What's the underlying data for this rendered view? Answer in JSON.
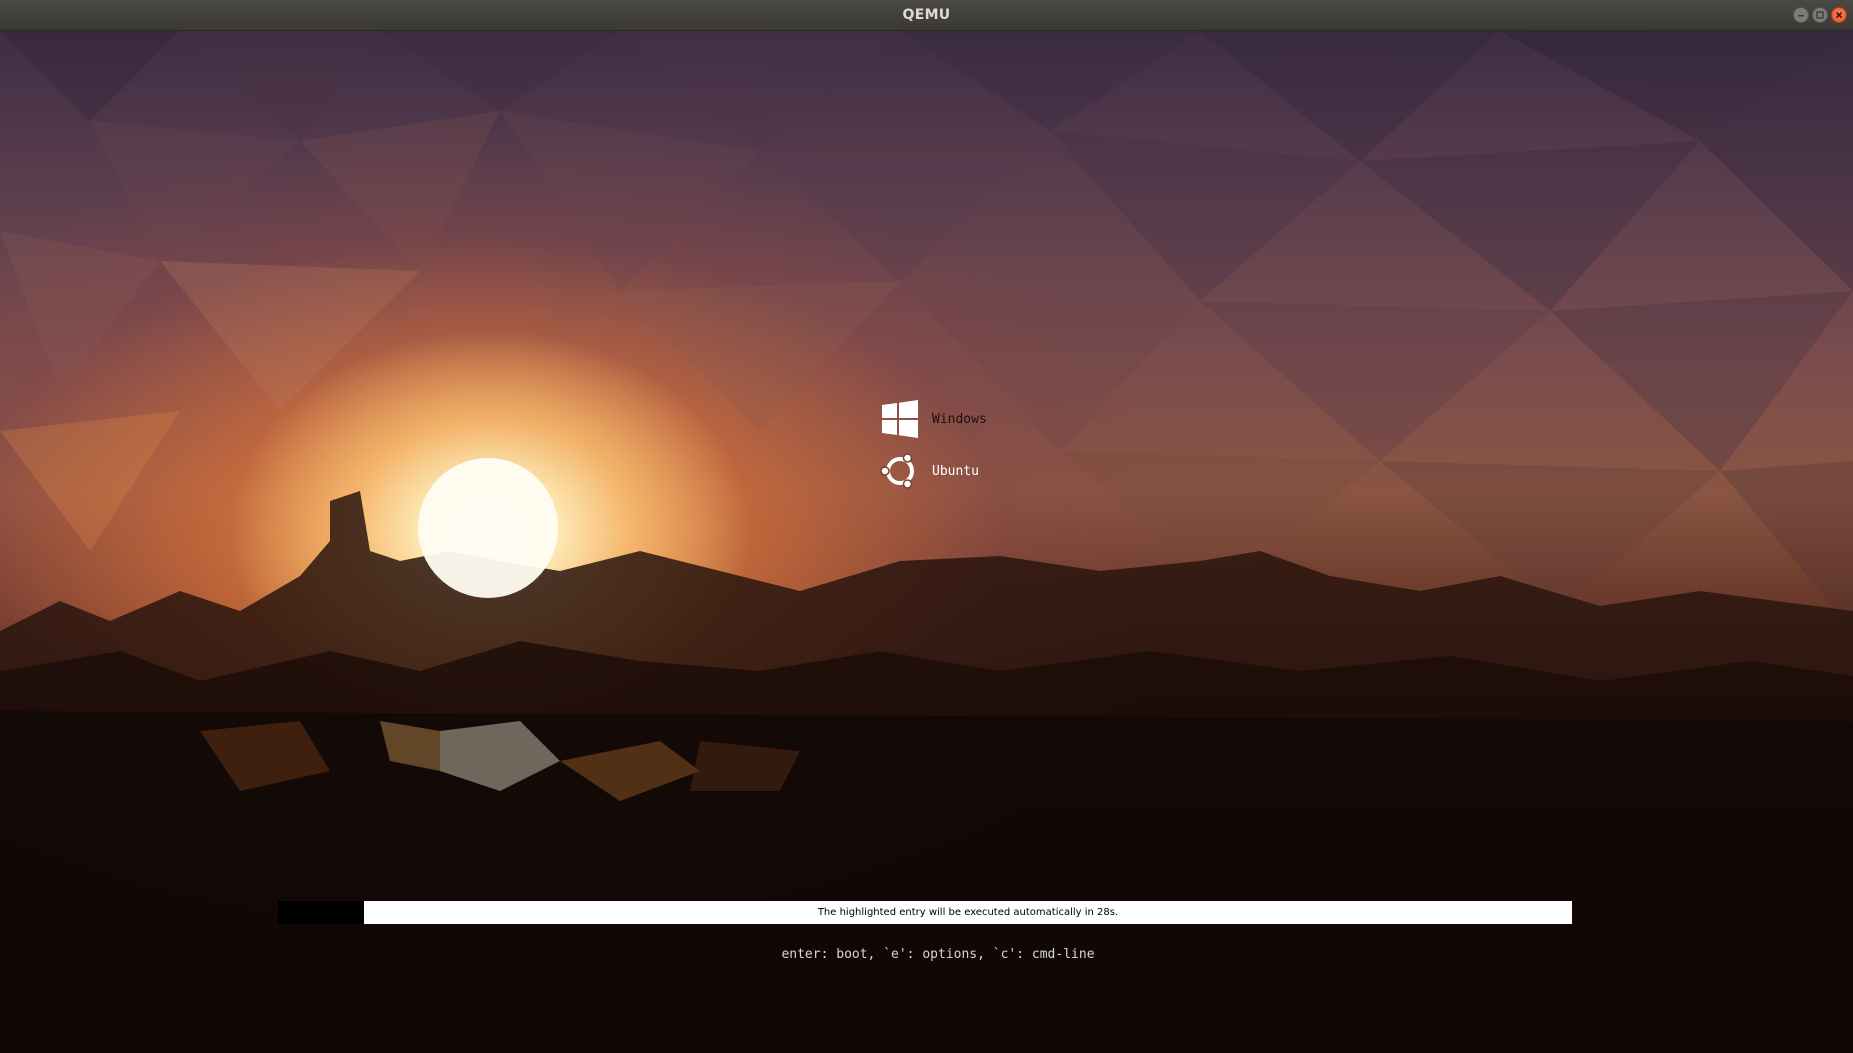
{
  "window": {
    "title": "QEMU",
    "controls": [
      "minimize-icon",
      "maximize-icon",
      "close-icon"
    ]
  },
  "boot_menu": {
    "entries": [
      {
        "label": "Windows",
        "icon": "windows-logo-icon",
        "selected": true
      },
      {
        "label": "Ubuntu",
        "icon": "ubuntu-logo-icon",
        "selected": false
      }
    ]
  },
  "timeout": {
    "message": "The highlighted entry will be executed automatically in 28s."
  },
  "help": {
    "text": "enter: boot, `e': options, `c': cmd-line"
  },
  "colors": {
    "titlebar": "#3d3c38",
    "close_button": "#e2521d",
    "progress_bar": "#ffffff",
    "menu_text": "#ffffff"
  }
}
